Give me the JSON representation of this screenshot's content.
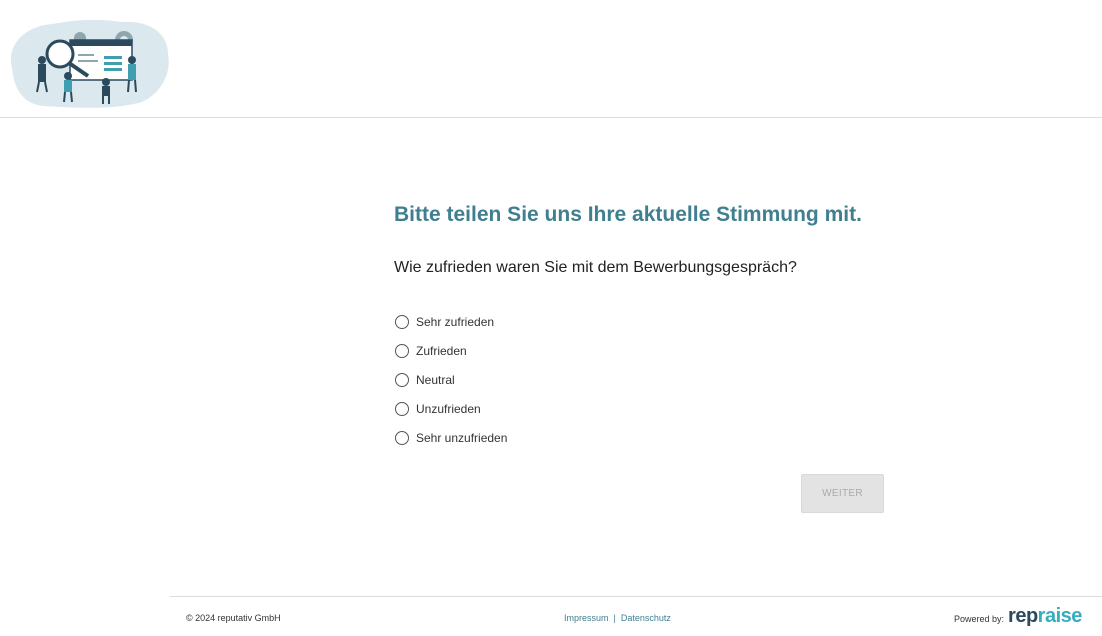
{
  "header": {
    "logo_icon": "recruiting-illustration-icon"
  },
  "survey": {
    "title": "Bitte teilen Sie uns Ihre aktuelle Stimmung mit.",
    "question": "Wie zufrieden waren Sie mit dem Bewerbungsgespräch?",
    "options": [
      {
        "label": "Sehr zufrieden",
        "selected": false
      },
      {
        "label": "Zufrieden",
        "selected": false
      },
      {
        "label": "Neutral",
        "selected": false
      },
      {
        "label": "Unzufrieden",
        "selected": false
      },
      {
        "label": "Sehr unzufrieden",
        "selected": false
      }
    ],
    "next_label": "WEITER",
    "next_enabled": false
  },
  "footer": {
    "copyright": "© 2024 reputativ GmbH",
    "impressum": "Impressum",
    "separator": "|",
    "datenschutz": "Datenschutz",
    "powered_by": "Powered by:",
    "brand_part1": "rep",
    "brand_part2": "raise"
  },
  "colors": {
    "accent": "#3f7f8f",
    "brand_dark": "#2b4a5e",
    "brand_light": "#35aec0",
    "button_disabled_bg": "#e3e3e3",
    "button_disabled_text": "#a9a9a9"
  }
}
